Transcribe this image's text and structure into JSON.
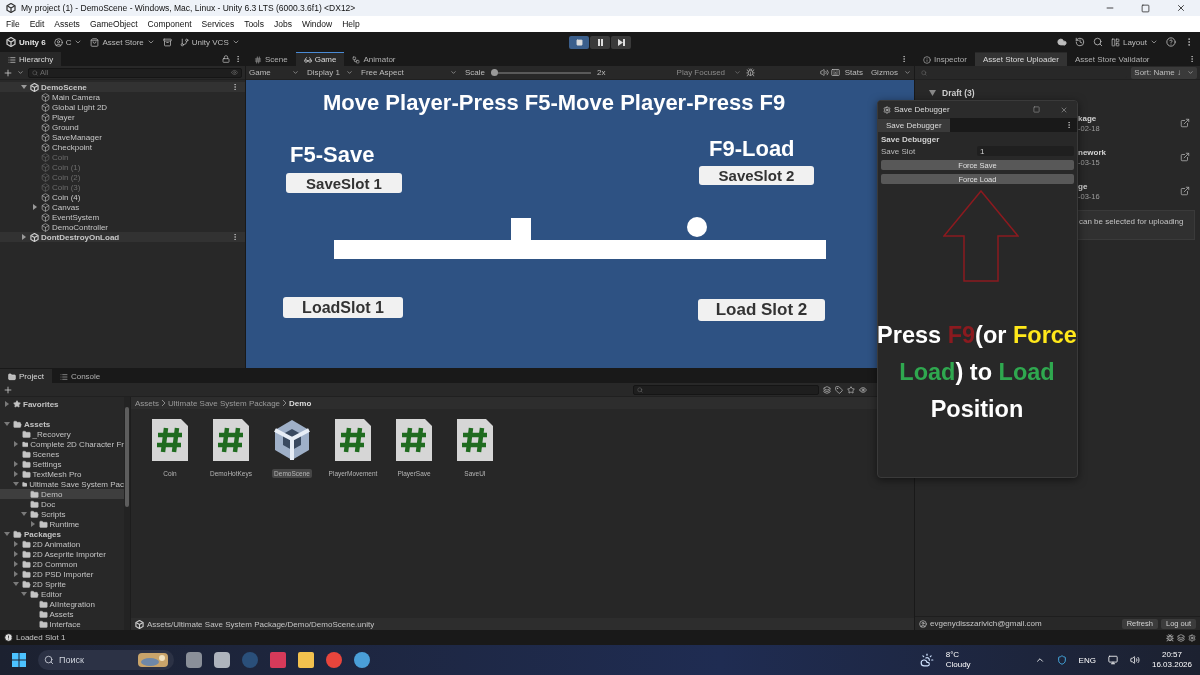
{
  "window": {
    "title": "My project (1) - DemoScene - Windows, Mac, Linux - Unity 6.3 LTS (6000.3.6f1) <DX12>"
  },
  "menu": [
    "File",
    "Edit",
    "Assets",
    "GameObject",
    "Component",
    "Services",
    "Tools",
    "Jobs",
    "Window",
    "Help"
  ],
  "toolbar": {
    "account": "Unity 6",
    "user": "C",
    "asset_store": "Asset Store",
    "vcs": "Unity VCS",
    "layout": "Layout",
    "play_controls": [
      {
        "kind": "stop",
        "on": true
      },
      {
        "kind": "pause",
        "on": false
      },
      {
        "kind": "step",
        "on": false
      }
    ]
  },
  "hierarchy": {
    "title": "Hierarchy",
    "placeholder": "All",
    "items": [
      {
        "label": "DemoScene",
        "kind": "scene",
        "expanded": true,
        "children": [
          {
            "label": "Main Camera",
            "kind": "object",
            "disabled": false
          },
          {
            "label": "Global Light 2D",
            "kind": "object",
            "disabled": false
          },
          {
            "label": "Player",
            "kind": "object",
            "disabled": false
          },
          {
            "label": "Ground",
            "kind": "object",
            "disabled": false
          },
          {
            "label": "SaveManager",
            "kind": "object",
            "disabled": false
          },
          {
            "label": "Checkpoint",
            "kind": "object",
            "disabled": false
          },
          {
            "label": "Coin",
            "kind": "object",
            "disabled": true
          },
          {
            "label": "Coin (1)",
            "kind": "object",
            "disabled": true
          },
          {
            "label": "Coin (2)",
            "kind": "object",
            "disabled": true
          },
          {
            "label": "Coin (3)",
            "kind": "object",
            "disabled": true
          },
          {
            "label": "Coin (4)",
            "kind": "object",
            "disabled": false
          },
          {
            "label": "Canvas",
            "kind": "object",
            "disabled": false,
            "expanded": false
          },
          {
            "label": "EventSystem",
            "kind": "object",
            "disabled": false
          },
          {
            "label": "DemoController",
            "kind": "object",
            "disabled": false
          }
        ]
      },
      {
        "label": "DontDestroyOnLoad",
        "kind": "scene",
        "expanded": false
      }
    ]
  },
  "scene_tabs": [
    {
      "label": "Scene",
      "kind": "scene",
      "selected": false
    },
    {
      "label": "Game",
      "kind": "game",
      "selected": true
    },
    {
      "label": "Animator",
      "kind": "animator",
      "selected": false
    }
  ],
  "game_toolbar": {
    "view": "Game",
    "display": "Display 1",
    "aspect": "Free Aspect",
    "scale_label": "Scale",
    "scale": {
      "level": 0.0
    },
    "scale_value": "2x",
    "play_focused": "Play Focused",
    "stats": "Stats",
    "gizmos": "Gizmos"
  },
  "game_view": {
    "title": "Move Player-Press F5-Move Player-Press F9",
    "headings": [
      "F5-Save",
      "F9-Load"
    ],
    "buttons": [
      "SaveSlot 1",
      "SaveSlot 2",
      "LoadSlot 1",
      "Load Slot 2"
    ]
  },
  "inspector": {
    "tabs": [
      {
        "label": "Inspector",
        "selected": false
      },
      {
        "label": "Asset Store Uploader",
        "selected": true
      },
      {
        "label": "Asset Store Validator",
        "selected": false
      }
    ],
    "sort": "Sort: Name ↓",
    "group": "Draft (3)",
    "packages": [
      {
        "name": "kage",
        "date": "-02-18"
      },
      {
        "name": "nework",
        "date": "-03-15"
      },
      {
        "name": "ge",
        "date": "-03-16"
      }
    ],
    "notice": "can be selected for uploading",
    "email": "evgenydisszarivich@gmail.com",
    "buttons": [
      "Refresh",
      "Log out"
    ]
  },
  "project": {
    "tabs": [
      {
        "label": "Project",
        "selected": true
      },
      {
        "label": "Console",
        "selected": false
      }
    ],
    "favorites": {
      "label": "Favorites",
      "expanded": false
    },
    "tree": [
      {
        "label": "Assets",
        "expanded": true,
        "selected": false,
        "children": [
          {
            "label": "_Recovery",
            "selected": false
          },
          {
            "label": "Complete 2D Character Fr",
            "expanded": false,
            "selected": false
          },
          {
            "label": "Scenes",
            "selected": false
          },
          {
            "label": "Settings",
            "expanded": false,
            "selected": false
          },
          {
            "label": "TextMesh Pro",
            "expanded": false,
            "selected": false
          },
          {
            "label": "Ultimate Save System Pac",
            "expanded": true,
            "selected": false,
            "children": [
              {
                "label": "Demo",
                "selected": true
              },
              {
                "label": "Doc",
                "selected": false
              },
              {
                "label": "Scripts",
                "expanded": true,
                "selected": false,
                "children": [
                  {
                    "label": "Runtime",
                    "expanded": false,
                    "selected": false
                  }
                ]
              }
            ]
          }
        ]
      },
      {
        "label": "Packages",
        "expanded": true,
        "selected": false,
        "children": [
          {
            "label": "2D Animation",
            "expanded": false,
            "selected": false
          },
          {
            "label": "2D Aseprite Importer",
            "expanded": false,
            "selected": false
          },
          {
            "label": "2D Common",
            "expanded": false,
            "selected": false
          },
          {
            "label": "2D PSD Importer",
            "expanded": false,
            "selected": false
          },
          {
            "label": "2D Sprite",
            "expanded": true,
            "selected": false,
            "children": [
              {
                "label": "Editor",
                "expanded": true,
                "selected": false,
                "children": [
                  {
                    "label": "AIIntegration",
                    "selected": false
                  },
                  {
                    "label": "Assets",
                    "selected": false
                  },
                  {
                    "label": "Interface",
                    "selected": false
                  }
                ]
              }
            ]
          }
        ]
      }
    ],
    "breadcrumb": [
      "Assets",
      "Ultimate Save System Package",
      "Demo"
    ],
    "assets": [
      {
        "label": "Coin",
        "kind": "script",
        "selected": false
      },
      {
        "label": "DemoHotKeys",
        "kind": "script",
        "selected": false
      },
      {
        "label": "DemoScene",
        "kind": "scene",
        "selected": true
      },
      {
        "label": "PlayerMovement",
        "kind": "script",
        "selected": false
      },
      {
        "label": "PlayerSave",
        "kind": "script",
        "selected": false
      },
      {
        "label": "SaveUI",
        "kind": "script",
        "selected": false
      }
    ],
    "path": "Assets/Ultimate Save System Package/Demo/DemoScene.unity"
  },
  "save_debugger": {
    "title": "Save Debugger",
    "tab": "Save Debugger",
    "heading": "Save Debugger",
    "slot_label": "Save Slot",
    "slot_value": "1",
    "buttons": [
      "Force Save",
      "Force Load"
    ]
  },
  "annotation": {
    "segments": [
      {
        "text": "Press ",
        "color": "#ffffff"
      },
      {
        "text": "F9",
        "color": "#8b1a1f"
      },
      {
        "text": "(or ",
        "color": "#ffffff"
      },
      {
        "text": "Force",
        "color": "#ffe81a"
      },
      {
        "text": " Load",
        "color": "#2fa84f"
      },
      {
        "text": ") to ",
        "color": "#ffffff"
      },
      {
        "text": "Load",
        "color": "#2fa84f"
      },
      {
        "text": " Position",
        "color": "#ffffff"
      }
    ]
  },
  "status_bar": {
    "message": "Loaded Slot 1"
  },
  "taskbar": {
    "placeholder": "Поиск",
    "temperature": "8°C",
    "weather": "Cloudy",
    "language": "ENG",
    "time": "20:57",
    "date": "16.03.2026"
  }
}
